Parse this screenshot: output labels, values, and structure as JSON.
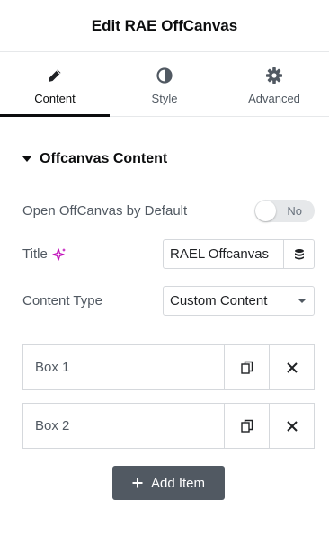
{
  "header": {
    "title": "Edit RAE OffCanvas"
  },
  "tabs": [
    {
      "label": "Content",
      "icon": "pencil-icon",
      "active": true
    },
    {
      "label": "Style",
      "icon": "contrast-icon",
      "active": false
    },
    {
      "label": "Advanced",
      "icon": "gear-icon",
      "active": false
    }
  ],
  "section": {
    "title": "Offcanvas Content"
  },
  "controls": {
    "open_by_default": {
      "label": "Open OffCanvas by Default",
      "state": "No"
    },
    "title": {
      "label": "Title",
      "value": "RAEL Offcanvas",
      "ai_icon": "sparkle-icon",
      "dynamic_icon": "database-icon"
    },
    "content_type": {
      "label": "Content Type",
      "value": "Custom Content"
    }
  },
  "repeater": {
    "items": [
      {
        "label": "Box 1"
      },
      {
        "label": "Box 2"
      }
    ],
    "add_label": "Add Item"
  },
  "colors": {
    "accent": "#515962",
    "ai": "#c00bb9",
    "border": "#d5d8dc"
  }
}
